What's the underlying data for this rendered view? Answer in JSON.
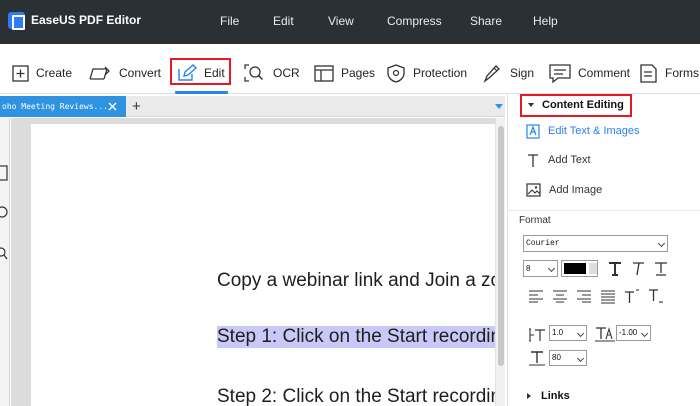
{
  "app": {
    "title": "EaseUS PDF Editor"
  },
  "menu": [
    "File",
    "Edit",
    "View",
    "Compress",
    "Share",
    "Help"
  ],
  "toolbar": {
    "create": "Create",
    "convert": "Convert",
    "edit": "Edit",
    "ocr": "OCR",
    "pages": "Pages",
    "protection": "Protection",
    "sign": "Sign",
    "comment": "Comment",
    "forms": "Forms"
  },
  "tabs": {
    "doc_tab": "oho Meeting Reviews...",
    "add": "+"
  },
  "document": {
    "lines": [
      "Copy a webinar link and Join a zo",
      "Step 1: Click on the Start recordin",
      "Step 2: Click on the Start recordin"
    ]
  },
  "panel": {
    "content_editing": "Content Editing",
    "edit_text_images": "Edit Text & Images",
    "add_text": "Add Text",
    "add_image": "Add Image",
    "format": "Format",
    "font": "Courier",
    "font_size": "8",
    "line_spacing": "1.0",
    "char_spacing": "-1.00",
    "scale": "80",
    "links": "Links"
  },
  "colors": {
    "accent": "#2a82ef",
    "highlight_box": "#e21c22",
    "titlebar": "#2b3035",
    "tab": "#2f93e0",
    "selection": "#c9c8f8"
  }
}
